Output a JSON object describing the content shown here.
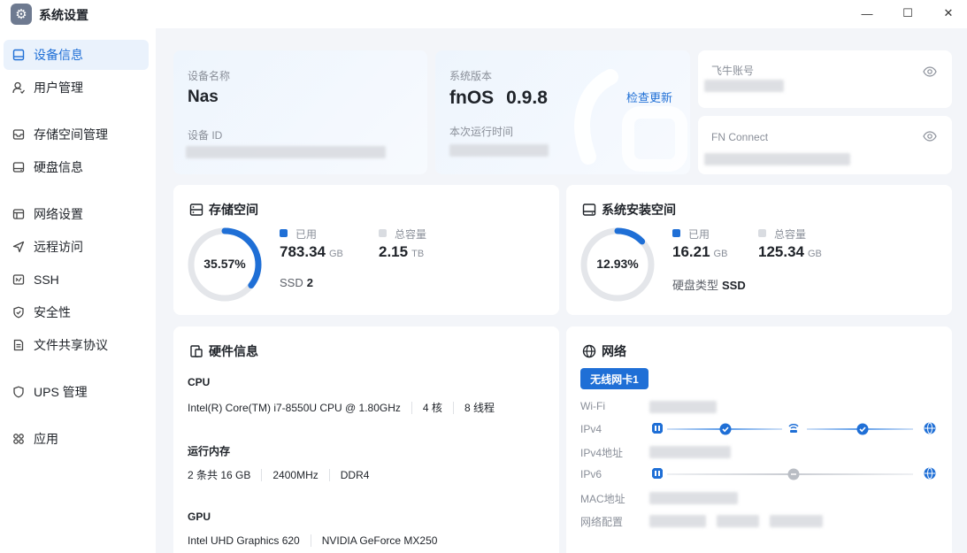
{
  "window": {
    "title": "系统设置",
    "minimize_glyph": "—",
    "maximize_glyph": "☐",
    "close_glyph": "✕"
  },
  "sidebar": {
    "items": [
      {
        "label": "设备信息",
        "icon": "device-icon",
        "active": true
      },
      {
        "label": "用户管理",
        "icon": "user-icon"
      },
      {
        "label": "存储空间管理",
        "icon": "storage-icon"
      },
      {
        "label": "硬盘信息",
        "icon": "disk-icon"
      },
      {
        "label": "网络设置",
        "icon": "network-icon"
      },
      {
        "label": "远程访问",
        "icon": "remote-icon"
      },
      {
        "label": "SSH",
        "icon": "ssh-icon"
      },
      {
        "label": "安全性",
        "icon": "shield-icon"
      },
      {
        "label": "文件共享协议",
        "icon": "file-share-icon"
      },
      {
        "label": "UPS 管理",
        "icon": "ups-icon"
      },
      {
        "label": "应用",
        "icon": "apps-icon"
      }
    ]
  },
  "device": {
    "name_label": "设备名称",
    "name_value": "Nas",
    "id_label": "设备 ID"
  },
  "system": {
    "version_label": "系统版本",
    "version_value": "fnOS",
    "version_number": "0.9.8",
    "check_update": "检查更新",
    "uptime_label": "本次运行时间"
  },
  "account": {
    "feiniu_label": "飞牛账号",
    "fnconnect_label": "FN Connect"
  },
  "storage": {
    "title": "存储空间",
    "percent_text": "35.57%",
    "percent": 35.57,
    "used_label": "已用",
    "used_value": "783.34",
    "used_unit": "GB",
    "total_label": "总容量",
    "total_value": "2.15",
    "total_unit": "TB",
    "disk_type": "SSD",
    "disk_count": "2"
  },
  "system_space": {
    "title": "系统安装空间",
    "percent_text": "12.93%",
    "percent": 12.93,
    "used_label": "已用",
    "used_value": "16.21",
    "used_unit": "GB",
    "total_label": "总容量",
    "total_value": "125.34",
    "total_unit": "GB",
    "disk_type_label": "硬盘类型",
    "disk_type_value": "SSD"
  },
  "hardware": {
    "title": "硬件信息",
    "cpu_label": "CPU",
    "cpu_model": "Intel(R) Core(TM) i7-8550U CPU @ 1.80GHz",
    "cpu_cores": "4 核",
    "cpu_threads": "8 线程",
    "ram_label": "运行内存",
    "ram_size": "2 条共 16 GB",
    "ram_freq": "2400MHz",
    "ram_type": "DDR4",
    "gpu_label": "GPU",
    "gpu_1": "Intel UHD Graphics 620",
    "gpu_2": "NVIDIA GeForce MX250"
  },
  "network": {
    "title": "网络",
    "nic_button": "无线网卡1",
    "wifi_label": "Wi-Fi",
    "ipv4_label": "IPv4",
    "ipv4_addr_label": "IPv4地址",
    "ipv6_label": "IPv6",
    "mac_label": "MAC地址",
    "config_label": "网络配置"
  },
  "colors": {
    "accent": "#1f6fd6",
    "ring_track": "#e4e6ea",
    "legend_total": "#d9dce1"
  }
}
